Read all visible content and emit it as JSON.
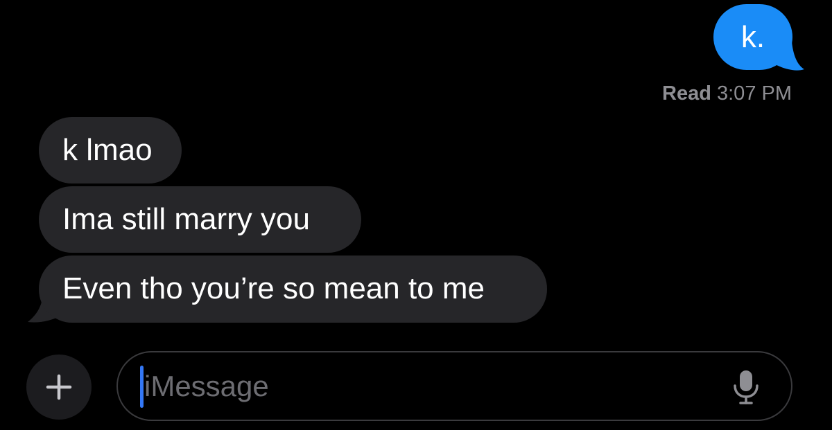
{
  "conversation": {
    "sent": [
      {
        "text": "k."
      }
    ],
    "read_receipt": {
      "status": "Read",
      "time": "3:07 PM"
    },
    "received": [
      {
        "text": "k lmao"
      },
      {
        "text": "Ima still marry you"
      },
      {
        "text": "Even tho you’re so mean to me"
      }
    ]
  },
  "composer": {
    "plus_icon": "plus-icon",
    "placeholder": "iMessage",
    "mic_icon": "microphone-icon"
  },
  "colors": {
    "background": "#000000",
    "sent_bubble": "#1a8cf7",
    "received_bubble": "#262629",
    "secondary_text": "#8e8e93",
    "cursor": "#3478f6"
  }
}
